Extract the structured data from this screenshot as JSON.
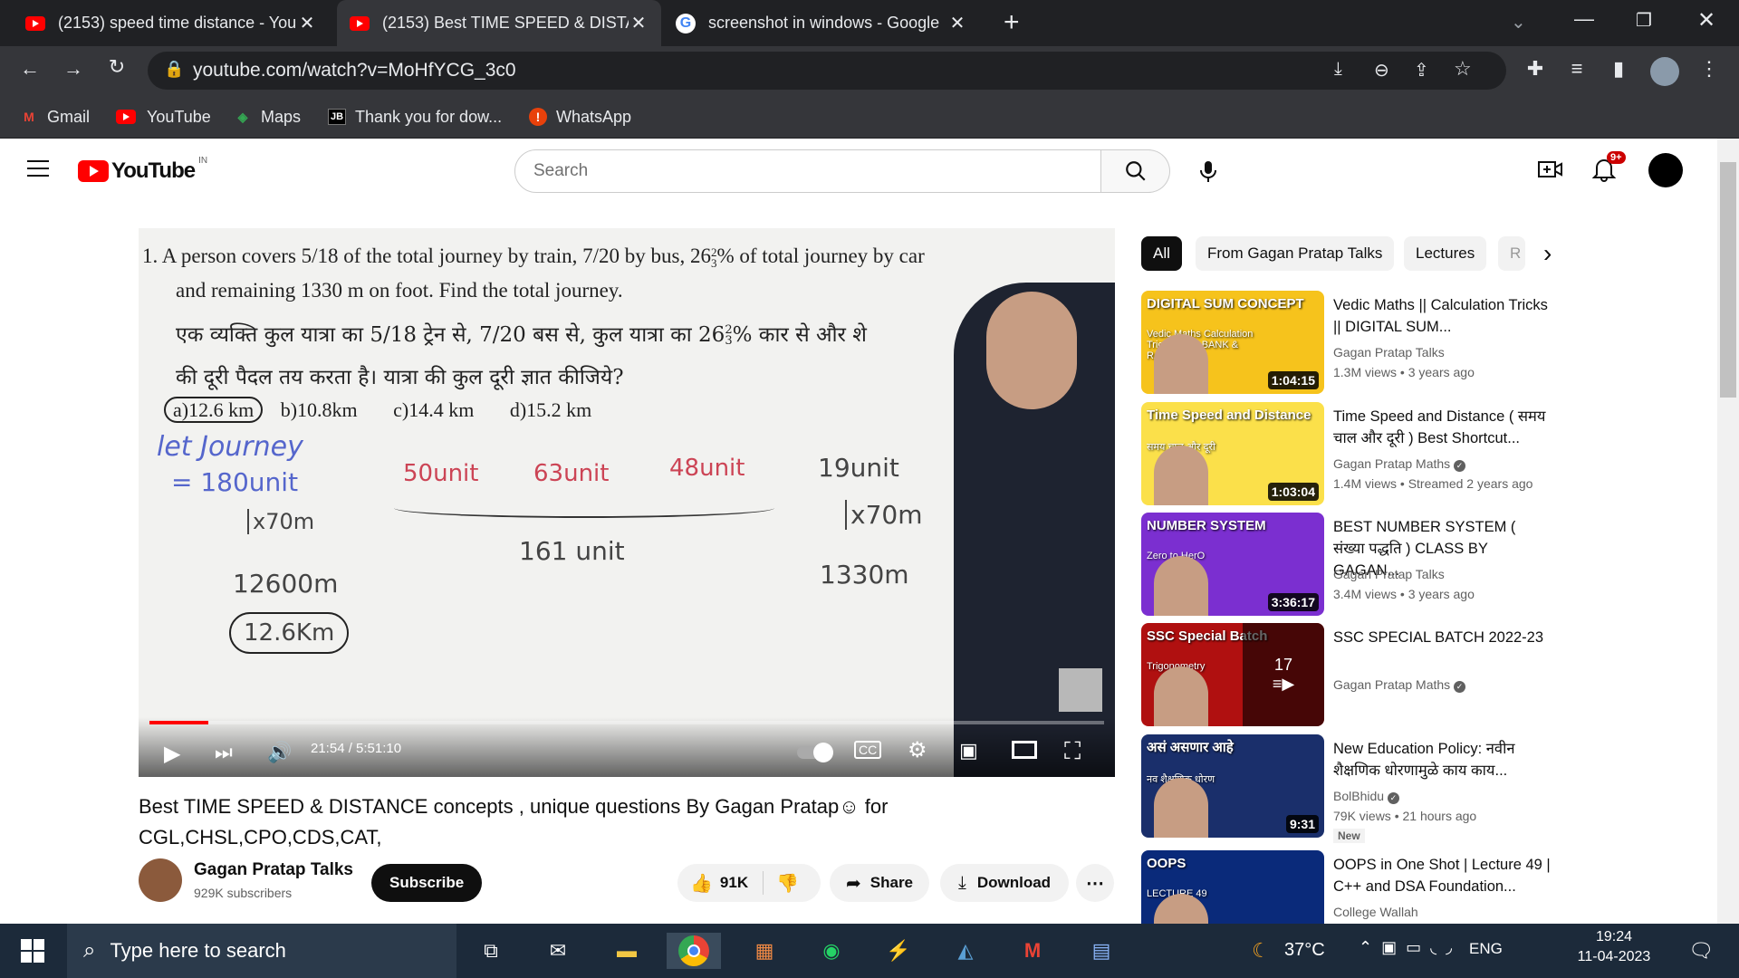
{
  "browser": {
    "tabs": [
      {
        "title": "(2153) speed time distance - You",
        "icon": "youtube-icon",
        "active": false
      },
      {
        "title": "(2153) Best TIME SPEED & DISTA",
        "icon": "youtube-icon",
        "active": true
      },
      {
        "title": "screenshot in windows - Google",
        "icon": "google-icon",
        "active": false
      }
    ],
    "new_tab": "+",
    "url": "youtube.com/watch?v=MoHfYCG_3c0",
    "bookmarks": [
      {
        "label": "Gmail",
        "icon": "gmail-icon"
      },
      {
        "label": "YouTube",
        "icon": "youtube-icon"
      },
      {
        "label": "Maps",
        "icon": "maps-icon"
      },
      {
        "label": "Thank you for dow...",
        "icon": "jetbrains-icon"
      },
      {
        "label": "WhatsApp",
        "icon": "whatsapp-icon"
      }
    ]
  },
  "youtube": {
    "logo_text": "YouTube",
    "region": "IN",
    "search_placeholder": "Search",
    "notification_count": "9+"
  },
  "video": {
    "question_en_1": "1.  A person covers 5/18 of the total journey by train, 7/20 by bus, 26",
    "question_en_1b": "% of total journey by car",
    "question_en_2": "and remaining 1330 m on foot. Find the total journey.",
    "question_hi_1": "एक व्यक्ति कुल यात्रा का 5/18 ट्रेन से, 7/20 बस से, कुल यात्रा का 26",
    "question_hi_1b": "%  कार से और शे",
    "question_hi_2": "की दूरी पैदल तय करता है। यात्रा की कुल दूरी ज्ञात कीजिये?",
    "frac_num": "2",
    "frac_den": "3",
    "options": [
      "a)12.6 km",
      "b)10.8km",
      "c)14.4 km",
      "d)15.2 km"
    ],
    "notes": {
      "let": "let Journey",
      "total": "= 180unit",
      "mul1": "x70m",
      "res1": "12600m",
      "res2": "12.6Km",
      "u1": "50unit",
      "u2": "63unit",
      "u3": "48unit",
      "u4": "19unit",
      "sum": "161 unit",
      "mul2": "x70m",
      "res3": "1330m"
    },
    "time": "21:54 / 5:51:10",
    "progress": 0.062,
    "title": "Best TIME SPEED & DISTANCE concepts , unique questions By Gagan Pratap☺ for CGL,CHSL,CPO,CDS,CAT,",
    "channel": "Gagan Pratap Talks",
    "subscribers": "929K subscribers",
    "subscribe": "Subscribe",
    "likes": "91K",
    "share": "Share",
    "download": "Download"
  },
  "chips": [
    "All",
    "From Gagan Pratap Talks",
    "Lectures",
    "R"
  ],
  "recommendations": [
    {
      "title": "Vedic Maths || Calculation Tricks || DIGITAL SUM...",
      "channel": "Gagan Pratap Talks",
      "verified": false,
      "meta": "1.3M views  • 3 years ago",
      "duration": "1:04:15",
      "thumb_text": "DIGITAL SUM CONCEPT",
      "thumb_sub": "Vedic Maths Calculation Tricks SSC, BANK & RAILWAY",
      "thumb_bg": "#f6c31c"
    },
    {
      "title": "Time Speed and Distance ( समय चाल और दूरी ) Best Shortcut...",
      "channel": "Gagan Pratap Maths",
      "verified": true,
      "meta": "1.4M views  • Streamed 2 years ago",
      "duration": "1:03:04",
      "thumb_text": "Time Speed and Distance",
      "thumb_sub": "समय चाल और दूरी",
      "thumb_bg": "#fbe04a"
    },
    {
      "title": "BEST NUMBER SYSTEM ( संख्या पद्धति ) CLASS BY GAGAN...",
      "channel": "Gagan Pratap Talks",
      "verified": false,
      "meta": "3.4M views  • 3 years ago",
      "duration": "3:36:17",
      "thumb_text": "NUMBER SYSTEM",
      "thumb_sub": "Zero to HerO",
      "thumb_bg": "#7b2fd0"
    },
    {
      "title": "SSC SPECIAL BATCH 2022-23",
      "channel": "Gagan Pratap Maths",
      "verified": true,
      "meta": "",
      "duration": "",
      "playlist_count": "17",
      "thumb_text": "SSC Special Batch",
      "thumb_sub": "Trigonometry",
      "thumb_bg": "#b01010"
    },
    {
      "title": "New Education Policy: नवीन शैक्षणिक धोरणामुळे काय काय...",
      "channel": "BolBhidu",
      "verified": true,
      "meta": "79K views  • 21 hours ago",
      "badge": "New",
      "duration": "9:31",
      "thumb_text": "असं असणार आहे",
      "thumb_sub": "नव शैक्षणिक धोरण",
      "thumb_bg": "#1a2f6b"
    },
    {
      "title": "OOPS in One Shot | Lecture 49 | C++ and DSA Foundation...",
      "channel": "College Wallah",
      "verified": false,
      "meta": "",
      "duration": "",
      "thumb_text": "OOPS",
      "thumb_sub": "LECTURE 49",
      "thumb_bg": "#0a2a7a"
    }
  ],
  "taskbar": {
    "search_placeholder": "Type here to search",
    "temperature": "37°C",
    "lang": "ENG",
    "time": "19:24",
    "date": "11-04-2023"
  },
  "colors": {
    "youtube_red": "#ff0000",
    "chrome_dark": "#35363a",
    "taskbar": "#1c2a3a"
  }
}
